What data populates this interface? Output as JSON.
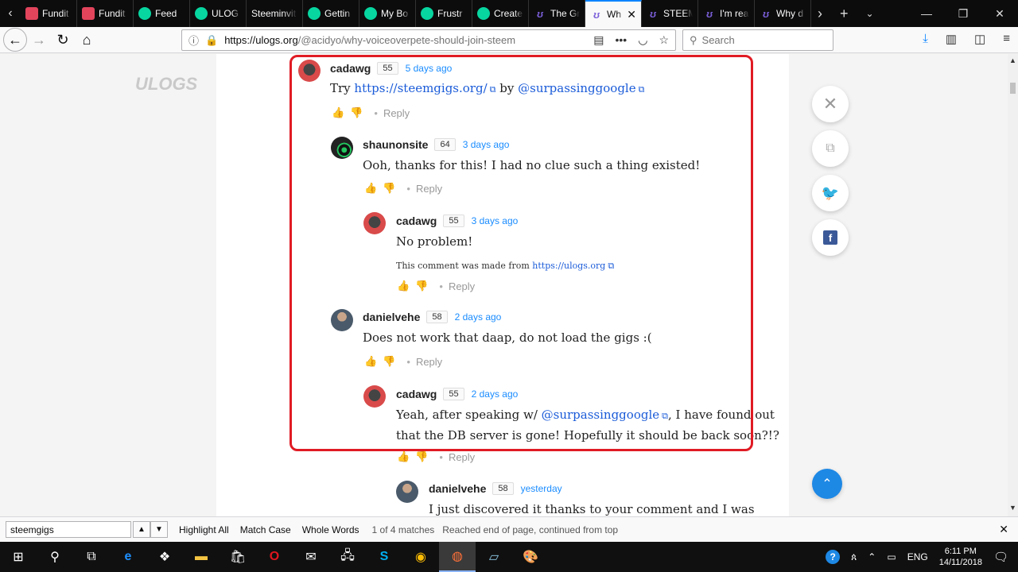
{
  "browser": {
    "tabs": [
      {
        "label": "Fundit",
        "icon": "fundition-icon"
      },
      {
        "label": "Fundit",
        "icon": "fundition-icon"
      },
      {
        "label": "Feed",
        "icon": "steemit-icon"
      },
      {
        "label": "ULOG",
        "icon": "steemit-icon"
      },
      {
        "label": "Steeminvit",
        "icon": "none"
      },
      {
        "label": "Gettin",
        "icon": "steemit-icon"
      },
      {
        "label": "My Bo",
        "icon": "steemit-icon"
      },
      {
        "label": "Frustr",
        "icon": "steemit-icon"
      },
      {
        "label": "Create",
        "icon": "steemit-icon"
      },
      {
        "label": "The Gr",
        "icon": "ulogs-icon"
      },
      {
        "label": "Wh",
        "icon": "ulogs-icon",
        "active": true
      },
      {
        "label": "STEEM",
        "icon": "ulogs-icon"
      },
      {
        "label": "I'm rea",
        "icon": "ulogs-icon"
      },
      {
        "label": "Why d",
        "icon": "ulogs-icon"
      }
    ],
    "url_host": "https://ulogs.org",
    "url_path": "/@acidyo/why-voiceoverpete-should-join-steem",
    "search_placeholder": "Search"
  },
  "comments": [
    {
      "user": "cadawg",
      "rep": "55",
      "time": "5 days ago",
      "body_prefix": "Try ",
      "link1": "https://steemgigs.org/",
      "body_mid": " by ",
      "link2": "@surpassinggoogle",
      "reply": "Reply"
    },
    {
      "user": "shaunonsite",
      "rep": "64",
      "time": "3 days ago",
      "body": "Ooh, thanks for this! I had no clue such a thing existed!",
      "reply": "Reply"
    },
    {
      "user": "cadawg",
      "rep": "55",
      "time": "3 days ago",
      "body": "No problem!",
      "note_prefix": "This comment was made from ",
      "note_link": "https://ulogs.org",
      "reply": "Reply"
    },
    {
      "user": "danielvehe",
      "rep": "58",
      "time": "2 days ago",
      "body": "Does not work that daap, do not load the gigs :(",
      "reply": "Reply"
    },
    {
      "user": "cadawg",
      "rep": "55",
      "time": "2 days ago",
      "line1_prefix": "Yeah, after speaking w/ ",
      "line1_link": "@surpassinggoogle",
      "line1_suffix": ", I have found out",
      "line2": "that the DB server is gone! Hopefully it should be back soon?!?",
      "reply": "Reply"
    },
    {
      "user": "danielvehe",
      "rep": "58",
      "time": "yesterday",
      "body": "I just discovered it thanks to your comment and I was"
    }
  ],
  "findbar": {
    "query": "steemgigs",
    "highlight_all": "Highlight All",
    "match_case": "Match Case",
    "whole_words": "Whole Words",
    "matches": "1 of 4 matches",
    "status": "Reached end of page, continued from top"
  },
  "taskbar": {
    "lang": "ENG",
    "time": "6:11 PM",
    "date": "14/11/2018"
  }
}
